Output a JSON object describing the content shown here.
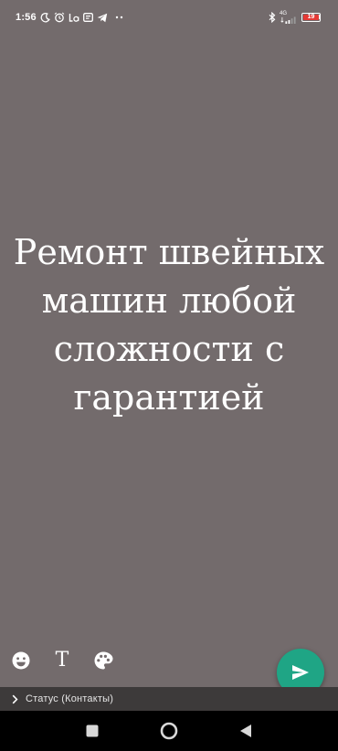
{
  "status_bar": {
    "time": "1:56",
    "network_type": "4G",
    "battery_level": "19",
    "battery_color": "#e53935",
    "icons_left": [
      "moon-icon",
      "alarm-icon",
      "la-app-icon",
      "message-icon",
      "telegram-icon",
      "more-dots-icon"
    ],
    "icons_right": [
      "bluetooth-icon",
      "signal-icon",
      "battery-icon"
    ]
  },
  "status": {
    "text": "Ремонт швейных машин любой сложности с гарантией",
    "background_color": "#736b6c"
  },
  "tools": {
    "emoji_icon": "emoji-icon",
    "text_label": "T",
    "palette_icon": "palette-icon"
  },
  "send": {
    "icon": "send-icon",
    "color": "#1fa585"
  },
  "audience": {
    "label": "Статус (Контакты)",
    "icon": "chevron-right-icon"
  },
  "nav": {
    "recent_icon": "square-icon",
    "home_icon": "circle-icon",
    "back_icon": "triangle-back-icon"
  }
}
